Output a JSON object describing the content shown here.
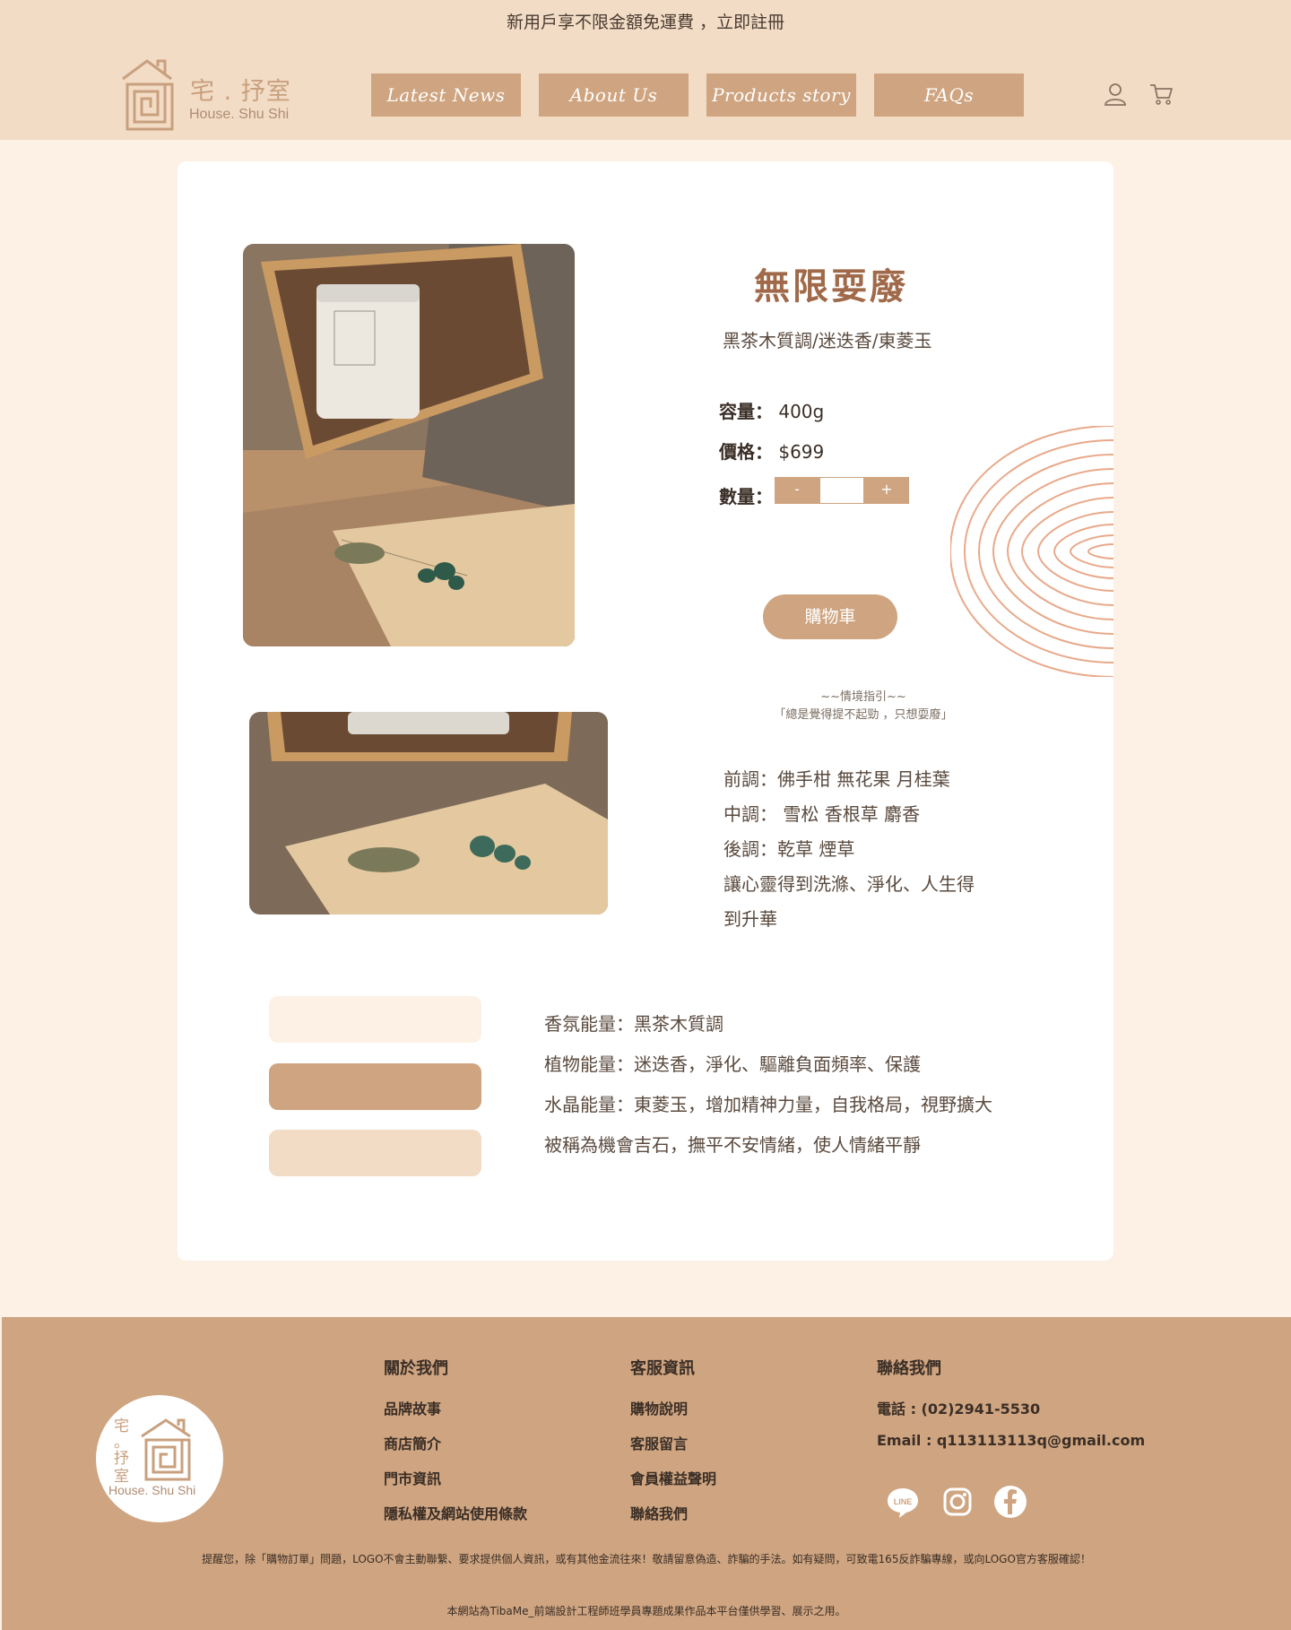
{
  "announcement": "新用戶享不限金額免運費 ，立即註冊",
  "logo": {
    "cn": "宅 . 抒室",
    "en": "House. Shu Shi"
  },
  "nav": [
    "Latest News",
    "About Us",
    "Products story",
    "FAQs"
  ],
  "header_icons": [
    "user-icon",
    "cart-icon"
  ],
  "product": {
    "title": "無限耍廢",
    "subtitle": "黑茶木質調/迷迭香/東菱玉",
    "capacity_label": "容量：",
    "capacity": "400g",
    "price_label": "價格：",
    "price": "$699",
    "qty_label": "數量：",
    "qty_minus": "-",
    "qty_plus": "+",
    "qty_value": "",
    "cart_button": "購物車",
    "scene_title": "~~情境指引~~",
    "scene_text": "「總是覺得提不起勁 ，只想耍廢」",
    "notes": [
      "前調：佛手柑 無花果 月桂葉",
      "中調： 雪松 香根草 麝香",
      "後調：乾草 煙草",
      "讓心靈得到洗滌、淨化、人生得",
      "到升華"
    ],
    "energy": [
      "香氛能量：黑茶木質調",
      "植物能量：迷迭香，淨化、驅離負面頻率、保護",
      "水晶能量：東菱玉，增加精神力量，自我格局，視野擴大",
      "被稱為機會吉石，撫平不安情緒，使人情緒平靜"
    ],
    "swatch_colors": [
      "#fdf1e6",
      "#cfa480",
      "#f2dcc6"
    ]
  },
  "footer": {
    "logo_text": {
      "cn1": "宅",
      "dot": "。",
      "cn2": "抒",
      "cn3": "室",
      "en": "House. Shu Shi"
    },
    "about": {
      "title": "關於我們",
      "items": [
        "品牌故事",
        "商店簡介",
        "門市資訊",
        "隱私權及網站使用條款"
      ]
    },
    "service": {
      "title": "客服資訊",
      "items": [
        "購物說明",
        "客服留言",
        "會員權益聲明",
        "聯絡我們"
      ]
    },
    "contact": {
      "title": "聯絡我們",
      "phone": "電話 : (02)2941-5530",
      "email": "Email : q113113113q@gmail.com",
      "line_text": "LINE"
    },
    "social_icons": [
      "line-icon",
      "instagram-icon",
      "facebook-icon"
    ],
    "warning": "提醒您，除「購物訂單」問題，LOGO不會主動聯繫、要求提供個人資訊，或有其他金流往來！敬請留意偽造、詐騙的手法。如有疑問，可致電165反詐騙專線，或向LOGO官方客服確認！",
    "copyright": "本網站為TibaMe_前端設計工程師班學員專題成果作品本平台僅供學習、展示之用。"
  },
  "colors": {
    "accent": "#cfa480",
    "header_bg": "#f2dcc6",
    "page_bg": "#fdf1e6",
    "title": "#a06a4a",
    "deco": "#e8a98a"
  }
}
